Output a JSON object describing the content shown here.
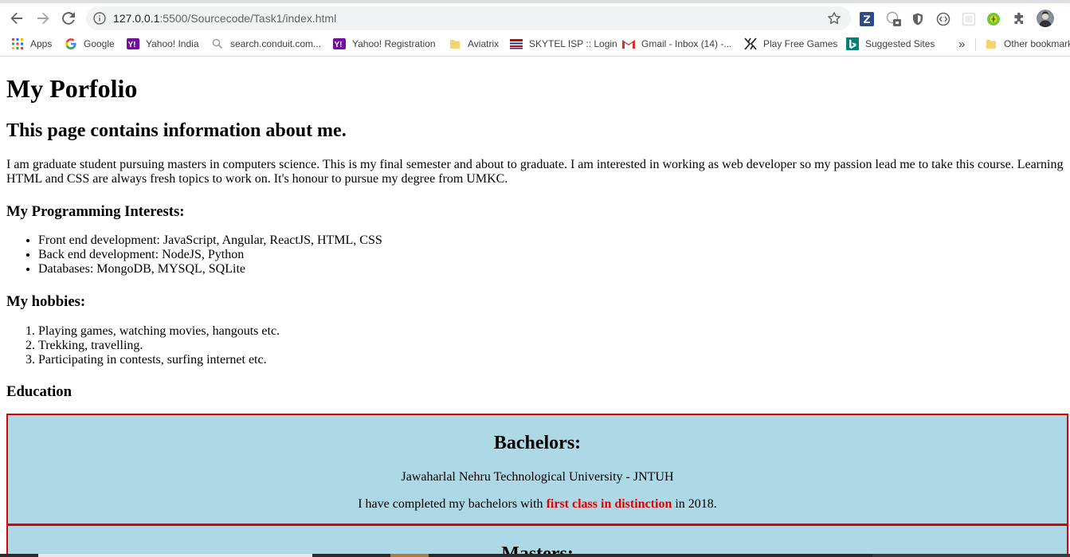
{
  "browser": {
    "url_host": "127.0.0.1",
    "url_path": ":5500/Sourcecode/Task1/index.html"
  },
  "bookmarks": [
    {
      "label": "Apps",
      "icon": "apps-grid-icon"
    },
    {
      "label": "Google",
      "icon": "google-icon"
    },
    {
      "label": "Yahoo! India",
      "icon": "yahoo-icon"
    },
    {
      "label": "search.conduit.com...",
      "icon": "search-icon"
    },
    {
      "label": "Yahoo! Registration",
      "icon": "yahoo-icon"
    },
    {
      "label": "Aviatrix",
      "icon": "folder-icon"
    },
    {
      "label": "SKYTEL ISP :: Login",
      "icon": "skytel-icon"
    },
    {
      "label": "Gmail - Inbox (14) -...",
      "icon": "gmail-icon"
    },
    {
      "label": "Play Free Games",
      "icon": "games-icon"
    },
    {
      "label": "Suggested Sites",
      "icon": "bing-icon"
    },
    {
      "label": "»",
      "icon": ""
    },
    {
      "label": "Other bookmarks",
      "icon": "folder-icon"
    }
  ],
  "page": {
    "title": "My Porfolio",
    "subtitle": "This page contains information about me.",
    "intro": "I am graduate student pursuing masters in computers science. This is my final semester and about to graduate. I am interested in working as web developer so my passion lead me to take this course. Learning HTML and CSS are always fresh topics to work on. It's honour to pursue my degree from UMKC.",
    "interests_heading": "My Programming Interests:",
    "interests": [
      "Front end development: JavaScript, Angular, ReactJS, HTML, CSS",
      "Back end development: NodeJS, Python",
      "Databases: MongoDB, MYSQL, SQLite"
    ],
    "hobbies_heading": "My hobbies:",
    "hobbies": [
      "Playing games, watching movies, hangouts etc.",
      "Trekking, travelling.",
      "Participating in contests, surfing internet etc."
    ],
    "education_heading": "Education",
    "bachelors": {
      "title": "Bachelors:",
      "university": "Jawaharlal Nehru Technological University - JNTUH",
      "text_before": "I have completed my bachelors with ",
      "highlight": "first class in distinction",
      "text_after": " in 2018."
    },
    "masters": {
      "title": "Masters:"
    }
  },
  "colors": {
    "box_background": "#add8e6",
    "box_border": "#e00000",
    "highlight": "#e00000"
  }
}
